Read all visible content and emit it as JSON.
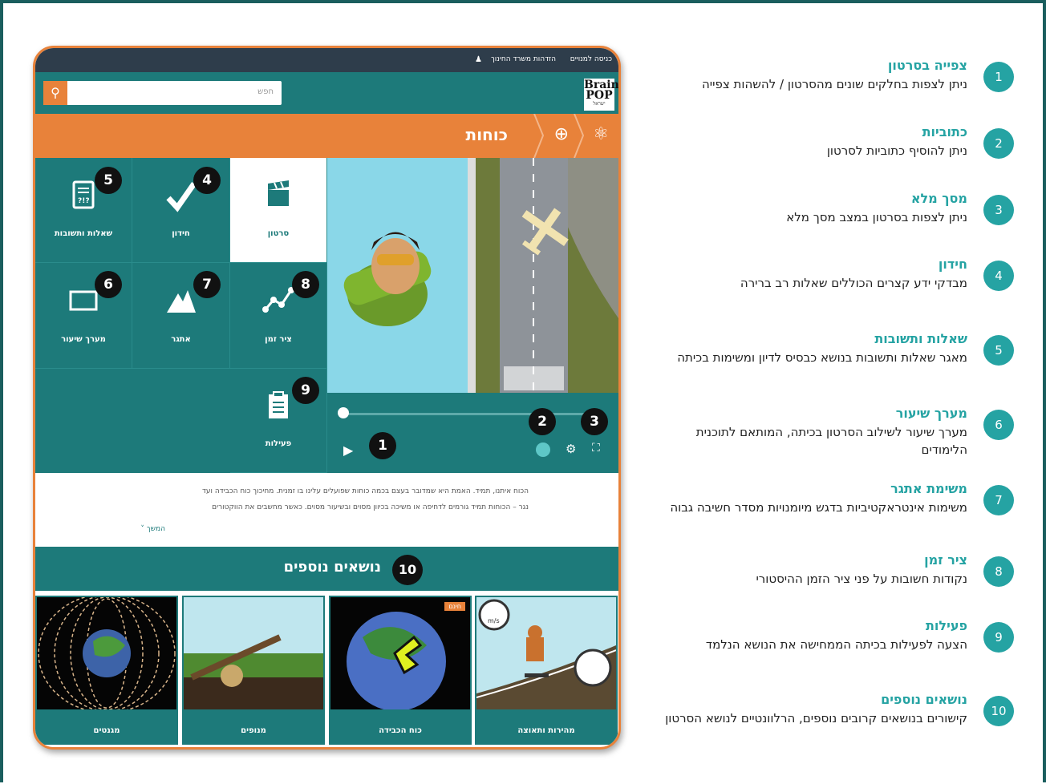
{
  "topbar": {
    "enter": "כניסה למנויים",
    "ministry": "הזדהות משרד החינוך"
  },
  "header": {
    "logo_main": "Brain",
    "logo_pop": "POP",
    "logo_sub": "ישראל",
    "search_placeholder": "חפש"
  },
  "topic": {
    "title": "כוחות"
  },
  "tiles": {
    "movie": "סרטון",
    "quiz": "חידון",
    "qa": "שאלות ותשובות",
    "timeline": "ציר זמן",
    "challenge": "אתגר",
    "lesson": "מערך שיעור",
    "activities": "פעילות"
  },
  "numbers": [
    "1",
    "2",
    "3",
    "4",
    "5",
    "6",
    "7",
    "8",
    "9",
    "10"
  ],
  "description": {
    "line1": "הכוח איתנו, תמיד. האמת היא שמדובר בעצם בכמה כוחות שפועלים עלינו בו זמנית. מחיכוך כוח הכבידה ועד",
    "line2": "נגר – הכוחות תמיד גורמים לדחיפה או משיכה בכיוון מסוים ובשיעור מסוים. כאשר מחשבים את הווקטורים",
    "more": "המשך ˅"
  },
  "more_topics": {
    "title": "נושאים נוספים",
    "badge": "חינם",
    "cards": [
      "מהירות ותאוצה",
      "כוח הכבידה",
      "מנופים",
      "מגנטים"
    ]
  },
  "legend": [
    {
      "num": "1",
      "title": "צפייה בסרטון",
      "desc": "ניתן לצפות בחלקים שונים מהסרטון / להשהות צפייה"
    },
    {
      "num": "2",
      "title": "כתוביות",
      "desc": "ניתן להוסיף כתוביות לסרטון"
    },
    {
      "num": "3",
      "title": "מסך מלא",
      "desc": "ניתן לצפות בסרטון במצב מסך מלא"
    },
    {
      "num": "4",
      "title": "חידון",
      "desc": "מבדקי ידע קצרים הכוללים שאלות רב ברירה"
    },
    {
      "num": "5",
      "title": "שאלות ותשובות",
      "desc": "מאגר שאלות ותשובות בנושא כבסיס לדיון ומשימות בכיתה"
    },
    {
      "num": "6",
      "title": "מערך שיעור",
      "desc": "מערך שיעור לשילוב הסרטון בכיתה, המותאם לתוכנית הלימודים"
    },
    {
      "num": "7",
      "title": "משימת אתגר",
      "desc": "משימות אינטראקטיביות בדגש מיומנויות מסדר חשיבה גבוה"
    },
    {
      "num": "8",
      "title": "ציר זמן",
      "desc": "נקודות חשובות על פני ציר הזמן ההיסטורי"
    },
    {
      "num": "9",
      "title": "פעילות",
      "desc": "הצעה לפעילות בכיתה הממחישה את הנושא הנלמד"
    },
    {
      "num": "10",
      "title": "נושאים נוספים",
      "desc": "קישורים בנושאים קרובים נוספים, הרלוונטיים לנושא הסרטון"
    }
  ],
  "speed_dial": "m/s",
  "colors": {
    "teal": "#1d7a7a",
    "orange": "#e8823a",
    "legend": "#25a3a3",
    "frame": "#1a5e5e"
  }
}
